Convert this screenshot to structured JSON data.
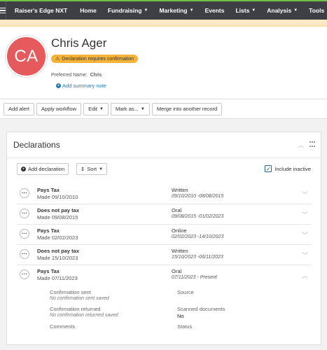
{
  "topbar": {
    "brand": "Raiser's Edge NXT",
    "nav": [
      {
        "label": "Home",
        "dropdown": false
      },
      {
        "label": "Fundraising",
        "dropdown": true
      },
      {
        "label": "Marketing",
        "dropdown": true
      },
      {
        "label": "Events",
        "dropdown": false
      },
      {
        "label": "Lists",
        "dropdown": true
      },
      {
        "label": "Analysis",
        "dropdown": true
      },
      {
        "label": "Tools",
        "dropdown": true
      }
    ]
  },
  "record": {
    "initials": "CA",
    "name": "Chris Ager",
    "warning": "Declaration requires confirmation",
    "preferred_name_label": "Preferred Name:",
    "preferred_name": "Chris",
    "summary_note_label": "Add summary note"
  },
  "toolbar": {
    "add_alert": "Add alert",
    "apply_workflow": "Apply workflow",
    "edit": "Edit",
    "mark_as": "Mark as...",
    "merge": "Merge into another record"
  },
  "declarations": {
    "title": "Declarations",
    "add_label": "Add declaration",
    "sort_label": "Sort",
    "include_inactive_label": "Include inactive",
    "include_inactive_checked": true,
    "rows": [
      {
        "status": "Pays Tax",
        "made": "Made 09/10/2010",
        "type": "Written",
        "period": "09/10/2010 -08/08/2015",
        "expanded": false
      },
      {
        "status": "Does not pay tax",
        "made": "Made 09/08/2015",
        "type": "Oral",
        "period": "09/08/2015 -01/02/2023",
        "expanded": false
      },
      {
        "status": "Pays Tax",
        "made": "Made 02/02/2023",
        "type": "Online",
        "period": "02/02/2023 -14/10/2023",
        "expanded": false
      },
      {
        "status": "Does not pay tax",
        "made": "Made 15/10/2023",
        "type": "Written",
        "period": "15/10/2023 -06/11/2023",
        "expanded": false
      },
      {
        "status": "Pays Tax",
        "made": "Made 07/11/2023",
        "type": "Oral",
        "period": "07/11/2023 - Present",
        "expanded": true
      }
    ],
    "detail": {
      "confirmation_sent_label": "Confirmation sent",
      "confirmation_sent_value": "No confirmation sent saved",
      "confirmation_returned_label": "Confirmation returned",
      "confirmation_returned_value": "No confirmation returned saved",
      "comments_label": "Comments",
      "source_label": "Source",
      "scanned_documents_label": "Scanned documents",
      "scanned_documents_value": "No",
      "status_label": "Status"
    }
  },
  "colors": {
    "topbar_bg": "#3d3f44",
    "accent_green": "#71bf44",
    "avatar_bg": "#e55a5c",
    "warning_badge": "#f5b338",
    "link": "#2a7ab0"
  }
}
